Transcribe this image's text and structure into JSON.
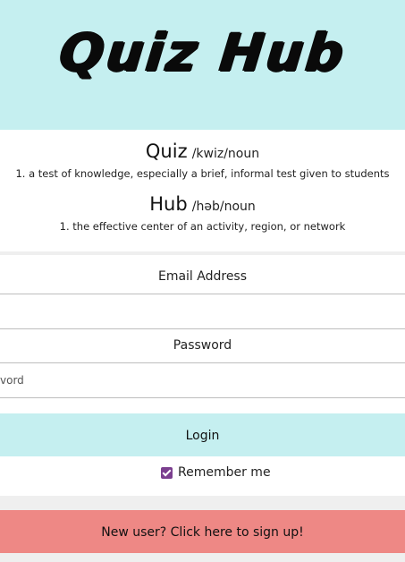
{
  "header": {
    "logo_text": "Quiz Hub",
    "background": "#c5eff0"
  },
  "definitions": [
    {
      "word": "Quiz",
      "pronunciation": "/kwiz/noun",
      "meaning": "1. a test of knowledge, especially a brief, informal test given to students"
    },
    {
      "word": "Hub",
      "pronunciation": "/həb/noun",
      "meaning": "1. the effective center of an activity, region, or network"
    }
  ],
  "form": {
    "email_label": "Email Address",
    "email_value": "",
    "password_label": "Password",
    "password_placeholder_visible": "vord",
    "login_label": "Login",
    "remember_label": "Remember me",
    "remember_checked": true
  },
  "signup": {
    "label": "New user? Click here to sign up!",
    "color": "#ee8885"
  },
  "colors": {
    "accent": "#c5eff0",
    "checkbox": "#7b3f8f"
  }
}
